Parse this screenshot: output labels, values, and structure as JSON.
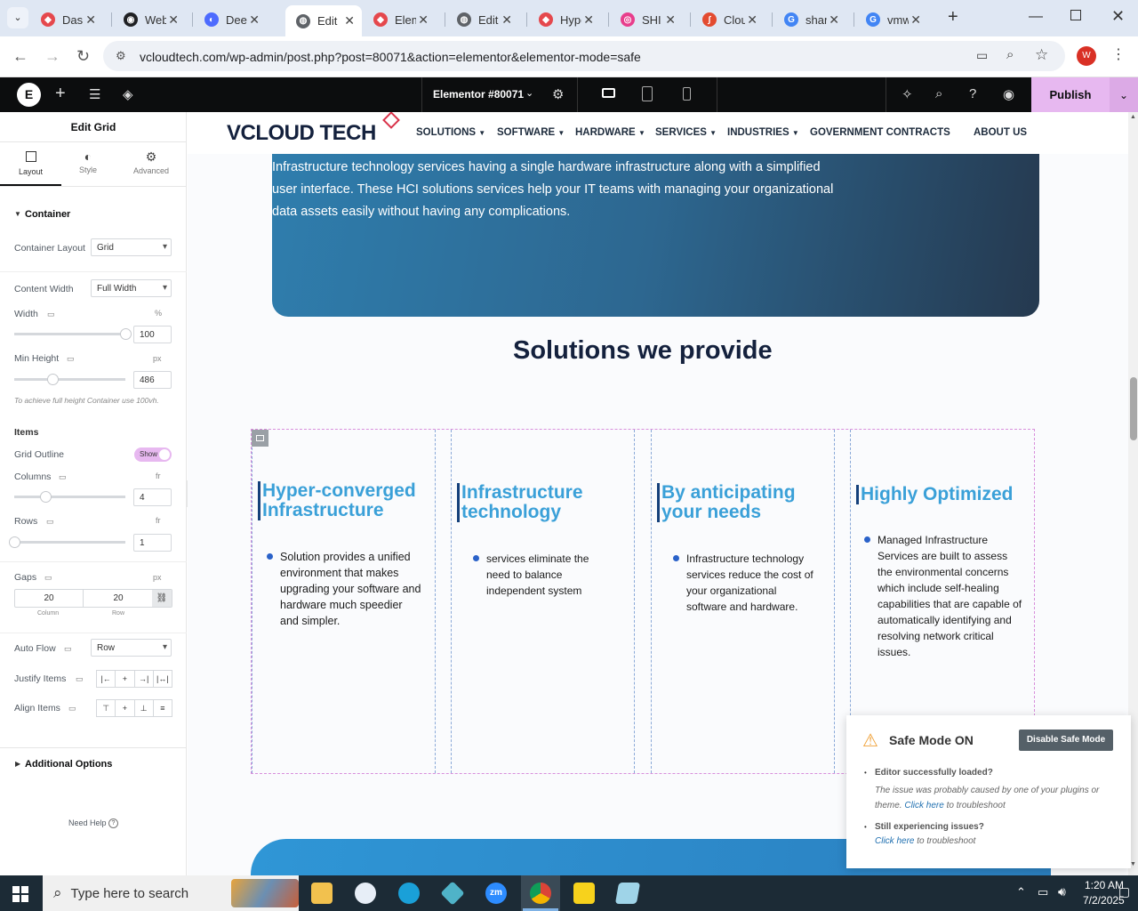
{
  "browser": {
    "tabs": [
      {
        "title": "Dashboard",
        "color": "#e5484d",
        "glyph": "◆"
      },
      {
        "title": "WebStats",
        "color": "#202124",
        "glyph": "◉"
      },
      {
        "title": "DeepSeek",
        "color": "#4d6bfe",
        "glyph": "◐"
      },
      {
        "title": "Edit",
        "color": "#5f6368",
        "glyph": "◍"
      },
      {
        "title": "Elementor",
        "color": "#e5484d",
        "glyph": "◆"
      },
      {
        "title": "Edit",
        "color": "#5f6368",
        "glyph": "◍"
      },
      {
        "title": "Hyper",
        "color": "#e5484d",
        "glyph": "◆"
      },
      {
        "title": "SHI",
        "color": "#e83e8c",
        "glyph": "◎"
      },
      {
        "title": "Cloud",
        "color": "#e34b30",
        "glyph": "∫"
      },
      {
        "title": "share",
        "color": "#4285f4",
        "glyph": "G"
      },
      {
        "title": "vmware",
        "color": "#4285f4",
        "glyph": "G"
      }
    ],
    "url": "vcloudtech.com/wp-admin/post.php?post=80071&action=elementor&elementor-mode=safe",
    "profile_initial": "W"
  },
  "elementor": {
    "doc_title": "Elementor #80071",
    "publish_label": "Publish",
    "panel": {
      "title": "Edit Grid",
      "tabs": [
        "Layout",
        "Style",
        "Advanced"
      ],
      "section": "Container",
      "container_layout_label": "Container Layout",
      "container_layout_value": "Grid",
      "content_width_label": "Content Width",
      "content_width_value": "Full Width",
      "width_label": "Width",
      "width_unit": "%",
      "width_value": "100",
      "width_level": 1.0,
      "min_height_label": "Min Height",
      "min_height_unit": "px",
      "min_height_value": "486",
      "min_height_level": 0.34,
      "min_height_note": "To achieve full height Container use 100vh.",
      "items_heading": "Items",
      "grid_outline_label": "Grid Outline",
      "grid_outline_value": "Show",
      "columns_label": "Columns",
      "columns_unit": "fr",
      "columns_value": "4",
      "columns_level": 0.28,
      "rows_label": "Rows",
      "rows_unit": "fr",
      "rows_value": "1",
      "rows_level": 0.0,
      "gaps_label": "Gaps",
      "gaps_unit": "px",
      "gap_column": "20",
      "gap_row": "20",
      "gap_column_caption": "Column",
      "gap_row_caption": "Row",
      "auto_flow_label": "Auto Flow",
      "auto_flow_value": "Row",
      "justify_items_label": "Justify Items",
      "align_items_label": "Align Items",
      "additional_options": "Additional Options",
      "need_help": "Need Help"
    }
  },
  "site": {
    "logo": "VCLOUD TECH",
    "menu": [
      "SOLUTIONS",
      "SOFTWARE",
      "HARDWARE",
      "SERVICES",
      "INDUSTRIES",
      "GOVERNMENT CONTRACTS",
      "ABOUT US"
    ],
    "hero_text": "Infrastructure technology services having a single hardware infrastructure along with a simplified user interface. These HCI solutions services help your IT teams with managing your organizational data assets easily without having any complications.",
    "section_title": "Solutions we provide",
    "columns": [
      {
        "heading": "Hyper-converged Infrastructure",
        "text": "Solution provides a unified environment that makes upgrading your software and hardware much speedier and simpler."
      },
      {
        "heading": "Infrastructure technology",
        "text": "services eliminate the need to balance independent system"
      },
      {
        "heading": "By anticipating your needs",
        "text": "Infrastructure technology services reduce the cost of your organizational software and hardware."
      },
      {
        "heading": "Highly Optimized",
        "text": "Managed Infrastructure Services are built to assess the environmental concerns which include self-healing capabilities that are capable of automatically identifying and resolving network critical issues."
      }
    ]
  },
  "safe_mode": {
    "title": "Safe Mode ON",
    "button": "Disable Safe Mode",
    "q1": "Editor successfully loaded?",
    "a1_text": "The issue was probably caused by one of your plugins or theme.",
    "a1_link": "Click here",
    "a1_tail": "to troubleshoot",
    "q2": "Still experiencing issues?",
    "a2_link": "Click here",
    "a2_tail": "to troubleshoot"
  },
  "taskbar": {
    "search_placeholder": "Type here to search",
    "time": "1:20 AM",
    "date": "7/2/2025"
  }
}
